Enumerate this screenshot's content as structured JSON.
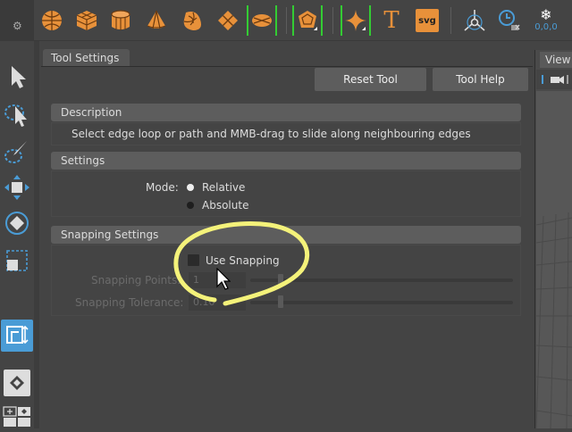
{
  "shelf": {
    "icons": [
      "grip-icon",
      "poly-sphere-icon",
      "poly-cube-icon",
      "poly-cylinder-icon",
      "poly-cone-icon",
      "poly-torus-icon",
      "poly-plane-icon",
      "disc-icon",
      "platonic-icon",
      "super-shape-icon",
      "type-icon",
      "svg-icon",
      "transform-axis-icon",
      "timer-icon",
      "snowflake-icon"
    ],
    "type_label": "T",
    "svg_label": "svg",
    "coord_label": "0,0,0"
  },
  "tool_settings": {
    "tab_title": "Tool Settings",
    "reset_button": "Reset Tool",
    "help_button": "Tool Help",
    "description_header": "Description",
    "description_text": "Select edge loop or path and MMB-drag to slide along neighbouring edges",
    "settings_header": "Settings",
    "mode_label": "Mode:",
    "mode_options": [
      "Relative",
      "Absolute"
    ],
    "mode_selected": "Relative",
    "snapping_header": "Snapping Settings",
    "use_snapping_label": "Use Snapping",
    "use_snapping_checked": false,
    "snapping_points_label": "Snapping Points:",
    "snapping_points_value": "1",
    "snapping_tolerance_label": "Snapping Tolerance:",
    "snapping_tolerance_value": "0.10"
  },
  "view_panel": {
    "tab_label": "View"
  },
  "colors": {
    "accent_orange": "#e8913a",
    "bracket_green": "#33cc33",
    "highlight_blue": "#4a9cd6",
    "annotation_yellow": "#f4f27a"
  }
}
